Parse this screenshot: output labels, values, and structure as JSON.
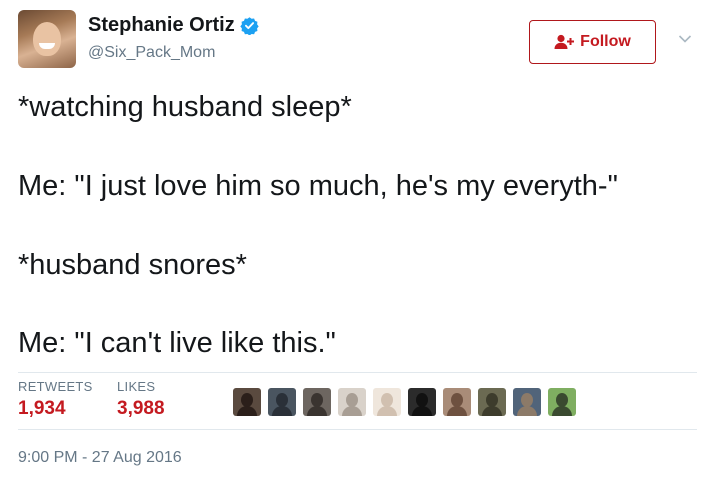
{
  "author": {
    "name": "Stephanie Ortiz",
    "handle": "@Six_Pack_Mom",
    "verified": true,
    "verified_color": "#1da1f2"
  },
  "header": {
    "follow_label": "Follow",
    "follow_color": "#c41a20"
  },
  "tweet": {
    "lines": [
      "*watching husband sleep*",
      "Me: \"I just love him so much, he's my everyth-\"",
      "*husband snores*",
      "Me: \"I can't live like this.\""
    ]
  },
  "stats": {
    "retweets_label": "RETWEETS",
    "retweets_count": "1,934",
    "likes_label": "LIKES",
    "likes_count": "3,988"
  },
  "likers": [
    {
      "bg": "#5a4a3f",
      "fg": "#2b1f1a"
    },
    {
      "bg": "#4a5560",
      "fg": "#2a3038"
    },
    {
      "bg": "#6d6660",
      "fg": "#3a3430"
    },
    {
      "bg": "#d9d2ca",
      "fg": "#a89e94"
    },
    {
      "bg": "#efe6dc",
      "fg": "#d1c0b0"
    },
    {
      "bg": "#2b2b2b",
      "fg": "#111111"
    },
    {
      "bg": "#a98c78",
      "fg": "#6e5140"
    },
    {
      "bg": "#6b6a52",
      "fg": "#3d3c2c"
    },
    {
      "bg": "#51647a",
      "fg": "#8c7a68"
    },
    {
      "bg": "#7fae61",
      "fg": "#3a4a30"
    }
  ],
  "timestamp": "9:00 PM - 27 Aug 2016"
}
